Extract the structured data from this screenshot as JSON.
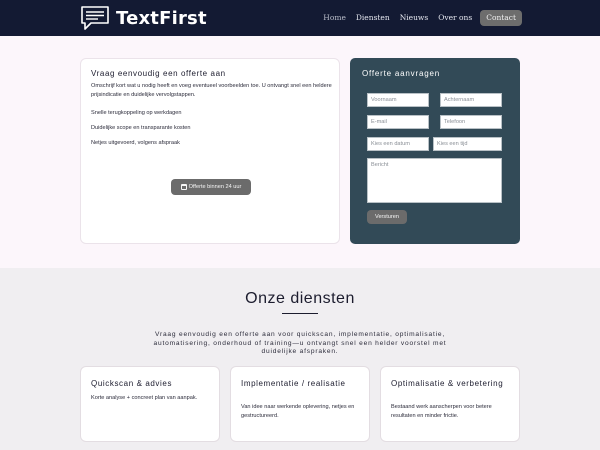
{
  "header": {
    "brand": "TextFirst",
    "nav": [
      "Home",
      "Diensten",
      "Nieuws",
      "Over ons",
      "Contact"
    ]
  },
  "intro": {
    "title": "Vraag eenvoudig een offerte aan",
    "description": "Omschrijf kort wat u nodig heeft en voeg eventueel voorbeelden toe. U ontvangt snel een heldere prijsindicatie en duidelijke vervolgstappen.",
    "features": [
      "Snelle terugkoppeling op werkdagen",
      "Duidelijke scope en transparante kosten",
      "Netjes uitgevoerd, volgens afspraak"
    ],
    "cta_label": "Offerte binnen 24 uur"
  },
  "quote_form": {
    "title": "Offerte aanvragen",
    "placeholders": {
      "first_name": "Voornaam",
      "last_name": "Achternaam",
      "email": "E-mail",
      "phone": "Telefoon",
      "date": "Kies een datum",
      "time": "Kies een tijd",
      "message": "Bericht"
    },
    "submit_label": "Versturen"
  },
  "services": {
    "title": "Onze diensten",
    "intro": "Vraag eenvoudig een offerte aan voor quickscan, implementatie, optimalisatie, automatisering, onderhoud of training—u ontvangt snel een helder voorstel met duidelijke afspraken.",
    "cards": [
      {
        "title": "Quickscan & advies",
        "description": "Korte analyse + concreet plan van aanpak."
      },
      {
        "title": "Implementatie / realisatie",
        "description": "Van idee naar werkende oplevering, netjes en gestructureerd."
      },
      {
        "title": "Optimalisatie & verbetering",
        "description": "Bestaand werk aanscherpen voor betere resultaten en minder frictie."
      }
    ]
  },
  "colors": {
    "navbar": "#131a33",
    "hero_bg": "#fcf6fb",
    "form_card": "#324a57",
    "button": "#6b6b6b",
    "section_bg": "#f0eef1"
  },
  "icons": [
    "chat-bubble-logo-icon",
    "calendar-icon"
  ]
}
